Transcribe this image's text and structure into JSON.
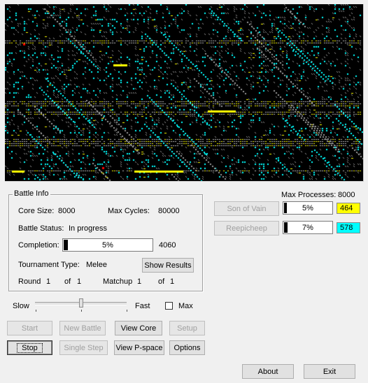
{
  "battle_info": {
    "legend": "Battle Info",
    "core_size_label": "Core Size:",
    "core_size_value": "8000",
    "max_cycles_label": "Max Cycles:",
    "max_cycles_value": "80000",
    "status_label": "Battle Status:",
    "status_value": "In progress",
    "completion_label": "Completion:",
    "completion_text": "5%",
    "completion_fraction": 0.05,
    "completion_count": "4060",
    "tournament_label": "Tournament Type:",
    "tournament_value": "Melee",
    "show_results_label": "Show Results",
    "round_label": "Round",
    "round_value": "1",
    "round_of": "of",
    "round_total": "1",
    "matchup_label": "Matchup",
    "matchup_value": "1",
    "matchup_of": "of",
    "matchup_total": "1"
  },
  "processes": {
    "max_label": "Max Processes:",
    "max_value": "8000"
  },
  "warriors": [
    {
      "name": "Son of Vain",
      "percent_text": "5%",
      "fraction": 0.05,
      "count": "464",
      "color": "#ffff00"
    },
    {
      "name": "Reepicheep",
      "percent_text": "7%",
      "fraction": 0.07,
      "count": "578",
      "color": "#00ffff"
    }
  ],
  "speed": {
    "slow_label": "Slow",
    "fast_label": "Fast",
    "max_label": "Max",
    "level_fraction": 0.5,
    "max_checked": false
  },
  "buttons": {
    "start": "Start",
    "new_battle": "New Battle",
    "view_core": "View Core",
    "setup": "Setup",
    "stop": "Stop",
    "single_step": "Single Step",
    "view_pspace": "View P-space",
    "options": "Options",
    "about": "About",
    "exit": "Exit"
  },
  "colors": {
    "core_background": "#000000",
    "warrior1": "#ffff00",
    "warrior2": "#00ffff",
    "empty_cell": "#9a9a9a",
    "executing": "#ff0000"
  }
}
